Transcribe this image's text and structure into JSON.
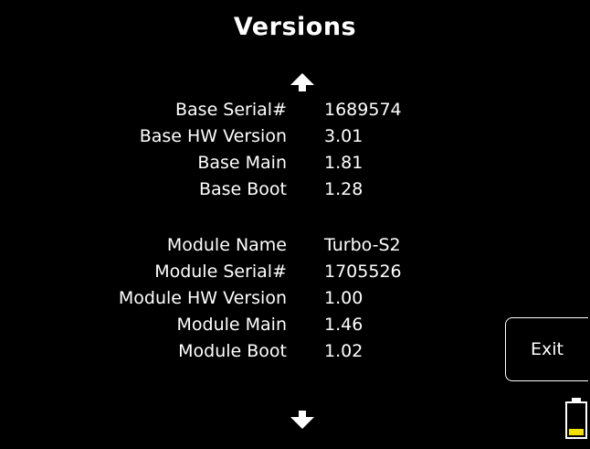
{
  "screen": {
    "title": "Versions"
  },
  "base": {
    "serial_label": "Base Serial#",
    "serial_value": "1689574",
    "hw_label": "Base HW Version",
    "hw_value": "3.01",
    "main_label": "Base Main",
    "main_value": "1.81",
    "boot_label": "Base Boot",
    "boot_value": "1.28"
  },
  "module": {
    "name_label": "Module Name",
    "name_value": "Turbo-S2",
    "serial_label": "Module Serial#",
    "serial_value": "1705526",
    "hw_label": "Module HW Version",
    "hw_value": "1.00",
    "main_label": "Module Main",
    "main_value": "1.46",
    "boot_label": "Module Boot",
    "boot_value": "1.02"
  },
  "controls": {
    "exit_label": "Exit",
    "up_icon": "arrow-up-icon",
    "down_icon": "arrow-down-icon"
  },
  "battery": {
    "icon": "battery-icon",
    "level": 0.2,
    "fill_color": "#f0e000"
  },
  "colors": {
    "background": "#000000",
    "text": "#ffffff"
  }
}
